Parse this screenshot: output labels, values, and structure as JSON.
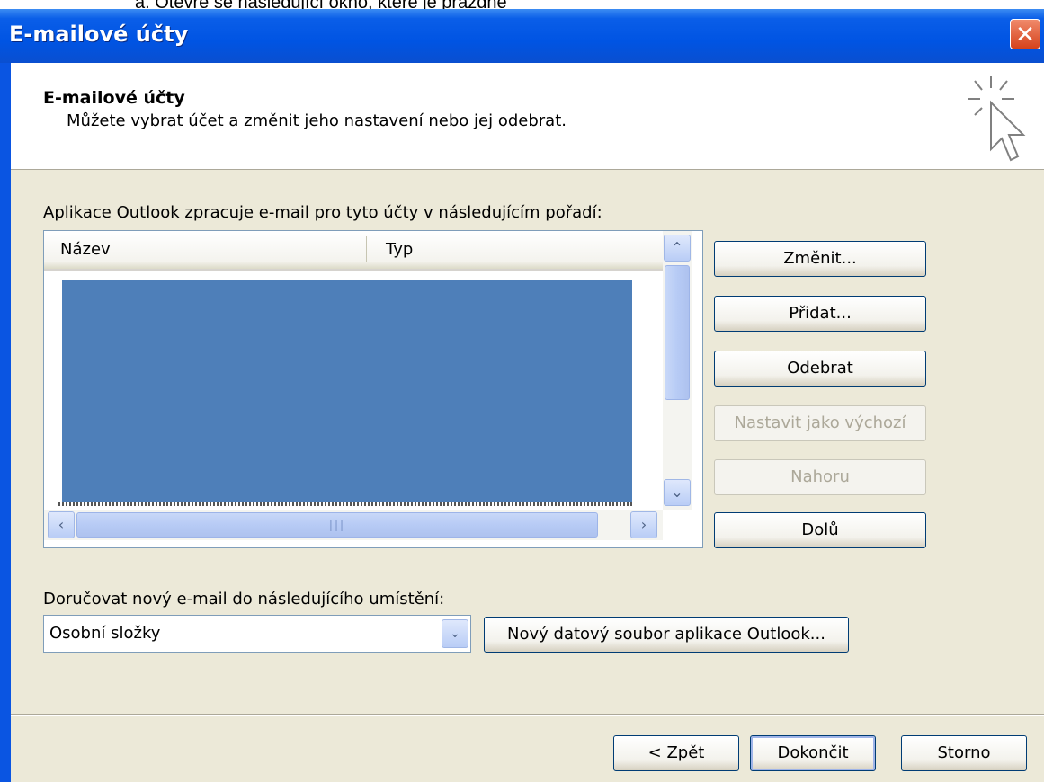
{
  "doc_caption": "a.   Otevře se následující okno, které je prázdné",
  "window": {
    "title": "E-mailové účty",
    "close_glyph": "✕"
  },
  "header": {
    "title": "E-mailové účty",
    "subtitle": "Můžete vybrat účet a změnit jeho nastavení nebo jej odebrat.",
    "icon": "cursor-sparkle-icon"
  },
  "accounts": {
    "label": "Aplikace Outlook zpracuje e-mail pro tyto účty v následujícím pořadí:",
    "columns": [
      "Název",
      "Typ"
    ],
    "rows": [],
    "selection_color": "#4e7fb9"
  },
  "side_buttons": [
    {
      "label": "Změnit...",
      "enabled": true
    },
    {
      "label": "Přidat...",
      "enabled": true
    },
    {
      "label": "Odebrat",
      "enabled": true
    },
    {
      "label": "Nastavit jako výchozí",
      "enabled": false
    },
    {
      "label": "Nahoru",
      "enabled": false
    },
    {
      "label": "Dolů",
      "enabled": true
    }
  ],
  "delivery": {
    "label": "Doručovat nový e-mail do následujícího umístění:",
    "selected": "Osobní složky",
    "new_file_button": "Nový datový soubor aplikace Outlook..."
  },
  "footer": {
    "back": "< Zpět",
    "finish": "Dokončit",
    "cancel": "Storno"
  },
  "colors": {
    "title_bar": "#0054e3",
    "dialog_bg": "#ece9d8",
    "close_button": "#d5421c"
  }
}
